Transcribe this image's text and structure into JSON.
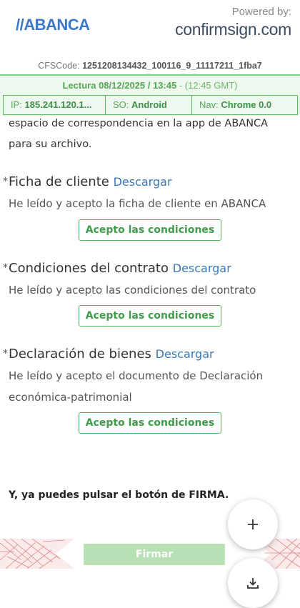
{
  "header": {
    "logo_text": "//ABANCA",
    "powered_by": "Powered by:",
    "brand": "confirmsign.com"
  },
  "cfs": {
    "label": "CFSCode:",
    "code": "1251208134432_100116_9_11117211_1fba7"
  },
  "reading": {
    "label": "Lectura 08/12/2025 / 13:45",
    "gmt": " - (12:45 GMT)"
  },
  "meta": {
    "ip_label": "IP:",
    "ip_value": "185.241.120.1...",
    "os_label": "SO:",
    "os_value": "Android",
    "nav_label": "Nav:",
    "nav_value": "Chrome 0.0"
  },
  "intro_text": "espacio de correspondencia en la app de ABANCA para su archivo.",
  "sections": [
    {
      "title": "Ficha de cliente",
      "download": "Descargar",
      "text": "He leído y acepto la ficha de cliente en ABANCA",
      "button": "Acepto las condiciones"
    },
    {
      "title": "Condiciones del contrato",
      "download": "Descargar",
      "text": "He leído y acepto las condiciones del contrato",
      "button": "Acepto las condiciones"
    },
    {
      "title": "Declaración de bienes",
      "download": "Descargar",
      "text": "He leído y acepto el documento de Declaración económica-patrimonial",
      "button": "Acepto las condiciones"
    }
  ],
  "required_mark": "*",
  "final_text": "Y, ya puedes pulsar el botón de FIRMA.",
  "sign_button": "Firmar",
  "colors": {
    "accent_green": "#4db35a",
    "link_blue": "#3a78b8",
    "brand_blue": "#3b78c6",
    "sign_disabled": "#b8e0b5"
  },
  "icons": [
    "plus-icon",
    "download-icon"
  ]
}
